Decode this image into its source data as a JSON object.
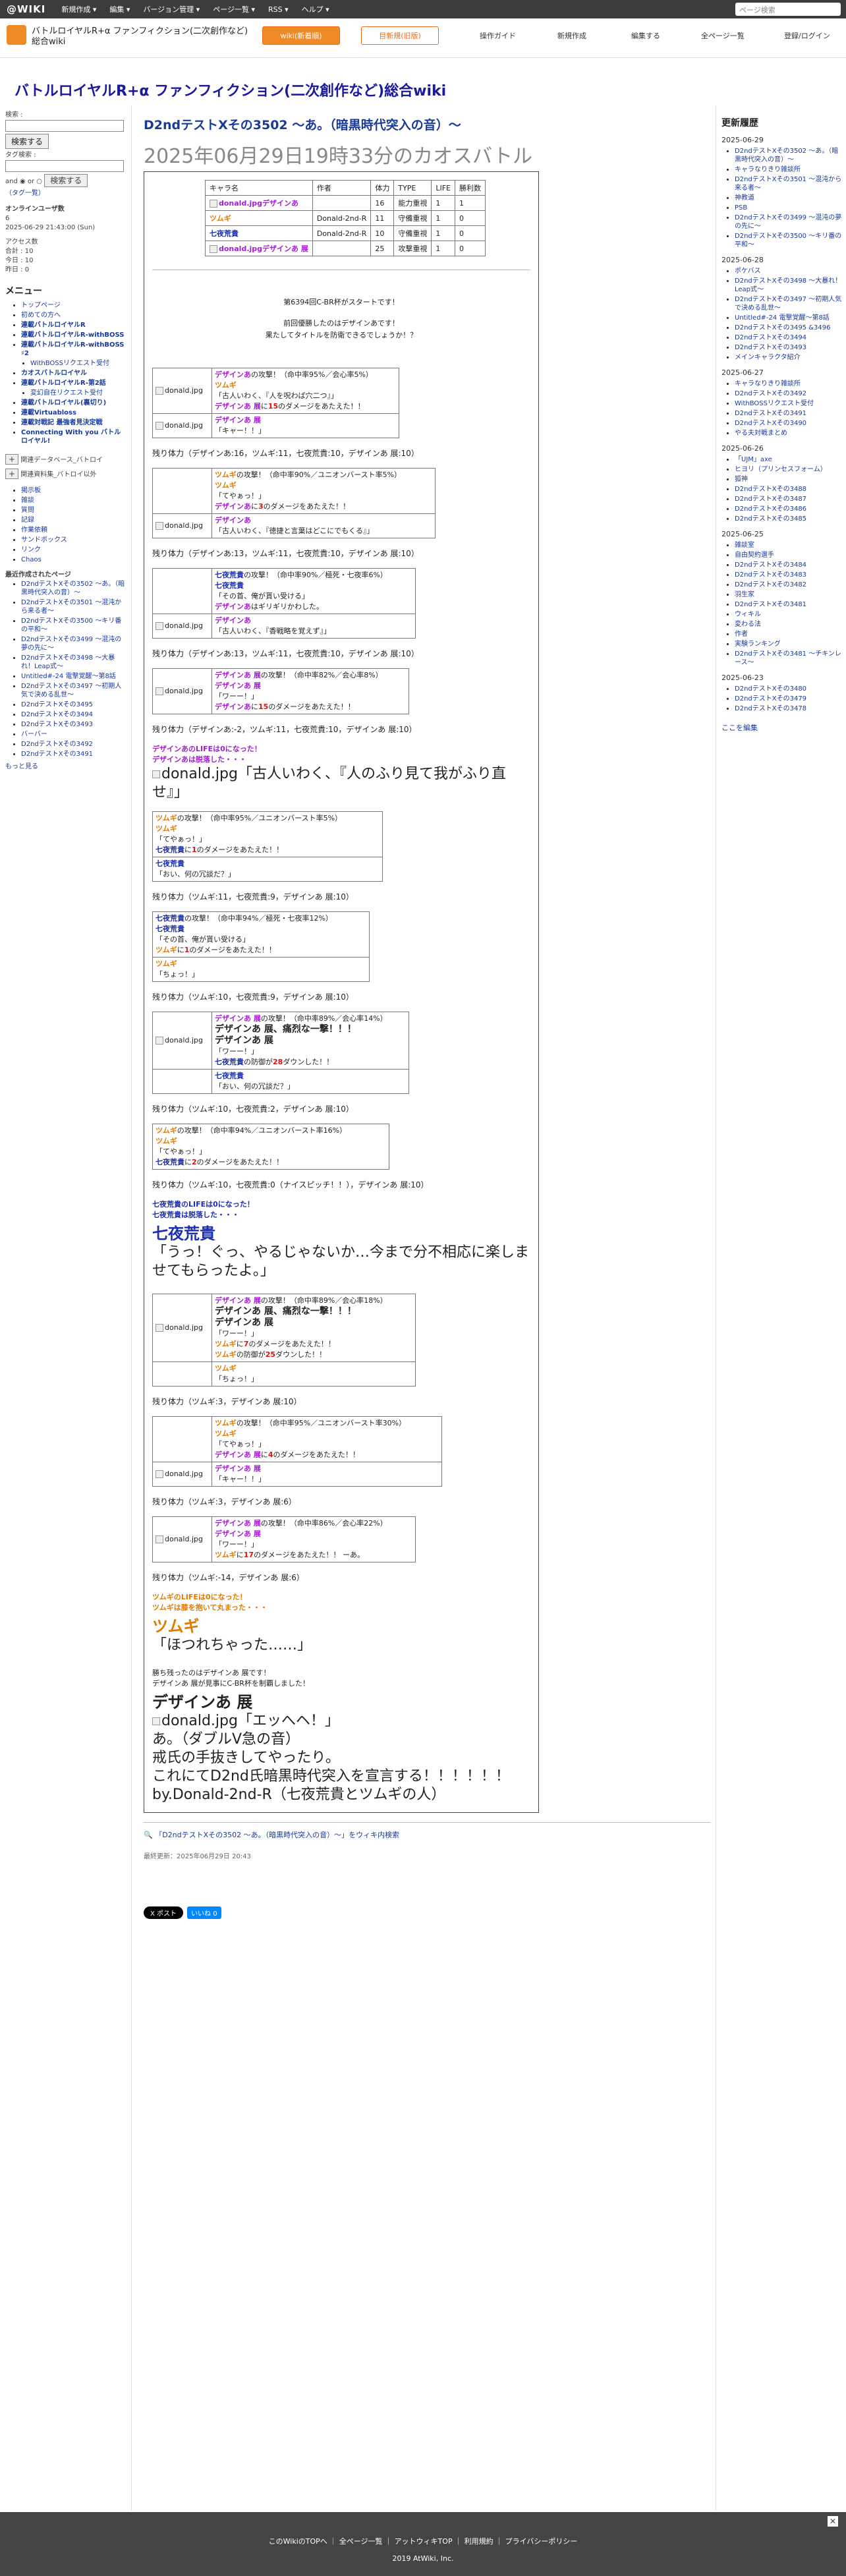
{
  "topbar": {
    "logo": "@WIKI",
    "items": [
      "新規作成 ▾",
      "編集 ▾",
      "バージョン管理 ▾",
      "ページ一覧 ▾",
      "RSS ▾",
      "ヘルプ ▾"
    ],
    "search_placeholder": "ページ検索"
  },
  "header": {
    "sitename": "バトルロイヤルR+α ファンフィクション(二次創作など)総合wiki",
    "btn1": "wiki(新着順)",
    "btn2": "目新規(旧版)",
    "nav": [
      "操作ガイド",
      "新規作成",
      "編集する",
      "全ページ一覧",
      "登録/ログイン"
    ]
  },
  "main_title": "バトルロイヤルR+α ファンフィクション(二次創作など)総合wiki",
  "left": {
    "search_label": "検索 :",
    "search_btn": "検索する",
    "tag_label": "タグ検索 :",
    "and_or": "and ◉ or ○",
    "tag_btn": "検索する",
    "tag_list": "（タグ一覧）",
    "online_title": "オンラインユーザ数",
    "online_n": "6",
    "online_time": "2025-06-29 21:43:00 (Sun)",
    "access": [
      "アクセス数",
      "合計 : 10",
      "今日 : 10",
      "昨日 : 0"
    ],
    "menu_title": "メニュー",
    "menu": [
      "トップページ",
      "初めての方へ",
      "連載バトルロイヤルR",
      "連載バトルロイヤルR-withBOSS",
      "連載バトルロイヤルR-withBOSS ♯2",
      "WithBOSSリクエスト受付",
      "カオスバトルロイヤル",
      "連載バトルロイヤルR-第2話",
      "変幻自在リクエスト受付",
      "連載バトルロイヤル(裏切り)",
      "連載Virtuabloss",
      "連載対戦記  最強者見決定戦",
      "Connecting With you バトルロイヤル!"
    ],
    "tree_a": "関連データベース_バトロイ",
    "tree_b": "関連資料集_バトロイ以外",
    "misc": [
      "掲示板",
      "雑談",
      "質問",
      "記録",
      "作業依頼",
      "サンドボックス",
      "リンク",
      "Chaos"
    ],
    "recent_title": "最近作成されたページ",
    "recent": [
      "D2ndテストXその3502 〜あ。（暗黒時代突入の音）〜",
      "D2ndテストXその3501 〜混沌から来る者〜",
      "D2ndテストXその3500 〜キリ番の平和〜",
      "D2ndテストXその3499 〜混沌の夢の先に〜",
      "D2ndテストXその3498 〜大暴れ！Leap式〜",
      "Untitled#-24 電撃覚醒〜第8話",
      "D2ndテストXその3497 〜初期人気で決める乱世〜",
      "D2ndテストXその3495",
      "D2ndテストXその3494",
      "D2ndテストXその3493",
      "バーバー",
      "D2ndテストXその3492",
      "D2ndテストXその3491"
    ],
    "more": "もっと見る"
  },
  "right": {
    "title": "更新履歴",
    "days": [
      {
        "date": "2025-06-29",
        "items": [
          "D2ndテストXその3502 〜あ。（暗黒時代突入の音）〜",
          "キャラなりきり雑談所",
          "D2ndテストXその3501 〜混沌から来る者〜",
          "神教道",
          "PSB",
          "D2ndテストXその3499 〜混沌の夢の先に〜",
          "D2ndテストXその3500 〜キリ番の平和〜"
        ]
      },
      {
        "date": "2025-06-28",
        "items": [
          "ポケバス",
          "D2ndテストXその3498 〜大暴れ！Leap式〜",
          "D2ndテストXその3497 〜初期人気で決める乱世〜",
          "Untitled#-24 電撃覚醒〜第8話",
          "D2ndテストXその3495 &3496",
          "D2ndテストXその3494",
          "D2ndテストXその3493",
          "メインキャラクタ紹介"
        ]
      },
      {
        "date": "2025-06-27",
        "items": [
          "キャラなりきり雑談所",
          "D2ndテストXその3492",
          "WithBOSSリクエスト受付",
          "D2ndテストXその3491",
          "D2ndテストXその3490",
          "やる夫対戦まとめ"
        ]
      },
      {
        "date": "2025-06-26",
        "items": [
          "「UJM」axe",
          "ヒヨリ（プリンセスフォーム）",
          "狐神",
          " D2ndテストXその3488",
          "D2ndテストXその3487",
          "D2ndテストXその3486",
          "D2ndテストXその3485"
        ]
      },
      {
        "date": "2025-06-25",
        "items": [
          "雑談室",
          "自由契約選手",
          "D2ndテストXその3484",
          "D2ndテストXその3483",
          "D2ndテストXその3482",
          "羽生家",
          "D2ndテストXその3481",
          "ウィキル",
          "変わる法",
          "作者",
          "実験ランキング",
          "D2ndテストXその3481 〜チキンレース〜"
        ]
      },
      {
        "date": "2025-06-23",
        "items": [
          "D2ndテストXその3480",
          "D2ndテストXその3479",
          "D2ndテストXその3478"
        ]
      }
    ],
    "edit_link": "ここを編集"
  },
  "content": {
    "h2": "D2ndテストXその3502 〜あ。（暗黒時代突入の音）〜",
    "date": "2025年06月29日19時33分のカオスバトル",
    "table_head": [
      "キャラ名",
      "作者",
      "体力",
      "TYPE",
      "LIFE",
      "勝利数"
    ],
    "table_rows": [
      [
        "donald.jpgデザインあ",
        "",
        "16",
        "能力重視",
        "1",
        "1"
      ],
      [
        "ツムギ",
        "Donald-2nd-R",
        "11",
        "守備重視",
        "1",
        "0"
      ],
      [
        "七夜荒貴",
        "Donald-2nd-R",
        "10",
        "守備重視",
        "1",
        "0"
      ],
      [
        "donald.jpgデザインあ 展",
        "",
        "25",
        "攻撃重視",
        "1",
        "0"
      ]
    ],
    "intro": [
      "第6394回C-BR杯がスタートです！",
      "前回優勝したのはデザインあです！",
      "果たしてタイトルを防衛できるでしょうか！？"
    ],
    "rem1": "残り体力（デザインあ:16，ツムギ:11，七夜荒貴:10，デザインあ 展:10）",
    "rem2": "残り体力（デザインあ:13，ツムギ:11，七夜荒貴:10，デザインあ 展:10）",
    "rem3": "残り体力（デザインあ:13，ツムギ:11，七夜荒貴:10，デザインあ 展:10）",
    "rem4": "残り体力（デザインあ:-2，ツムギ:11，七夜荒貴:10，デザインあ 展:10）",
    "lose1": "デザインあのLIFEは0になった！",
    "lose1b": "デザインあは脱落した・・・",
    "quote1": "donald.jpg「古人いわく、『人のふり見て我がふり直せ』」",
    "rem5": "残り体力（ツムギ:11，七夜荒貴:9，デザインあ 展:10）",
    "rem6": "残り体力（ツムギ:10，七夜荒貴:9，デザインあ 展:10）",
    "rem7": "残り体力（ツムギ:10，七夜荒貴:2，デザインあ 展:10）",
    "rem8": "残り体力（ツムギ:10，七夜荒貴:0（ナイスピッチ！！），デザインあ 展:10）",
    "lose2": "七夜荒貴のLIFEは0になった！",
    "lose2b": "七夜荒貴は脱落した・・・",
    "sy_name": "七夜荒貴",
    "sy_quote": "「うっ！ぐっ、やるじゃないか…今まで分不相応に楽しませてもらったよ。」",
    "rem9": "残り体力（ツムギ:3，デザインあ 展:10）",
    "rem10": "残り体力（ツムギ:3，デザインあ 展:6）",
    "rem11": "残り体力（ツムギ:-14，デザインあ 展:6）",
    "lose3": "ツムギのLIFEは0になった！",
    "lose3b": "ツムギは膝を抱いて丸まった・・・",
    "ts_name": "ツムギ",
    "ts_quote": "「ほつれちゃった……」",
    "win1": "勝ち残ったのはデザインあ 展です！",
    "win2": "デザインあ 展が見事にC-BR杯を制覇しました！",
    "win_name": "デザインあ 展",
    "win_quote": "donald.jpg「エッへヘ！」",
    "end1": "あ。（ダブルV急の音）",
    "end2": "戒氏の手抜きしてやったり。",
    "end3": "これにてD2nd氏暗黒時代突入を宣言する！！！！！！",
    "end4": "by.Donald-2nd-R（七夜荒貴とツムギの人）",
    "search_link": "「D2ndテストXその3502 〜あ。（暗黒時代突入の音）〜」をウィキ内検索",
    "updated": "最終更新：2025年06月29日 20:43",
    "share": "X ポスト",
    "like": "いいね 0"
  },
  "footer": {
    "links": [
      "このWikiのTOPへ",
      "全ページ一覧",
      "アットウィキTOP",
      "利用規約",
      "プライバシーポリシー"
    ],
    "copy": "2019 AtWiki, Inc."
  }
}
